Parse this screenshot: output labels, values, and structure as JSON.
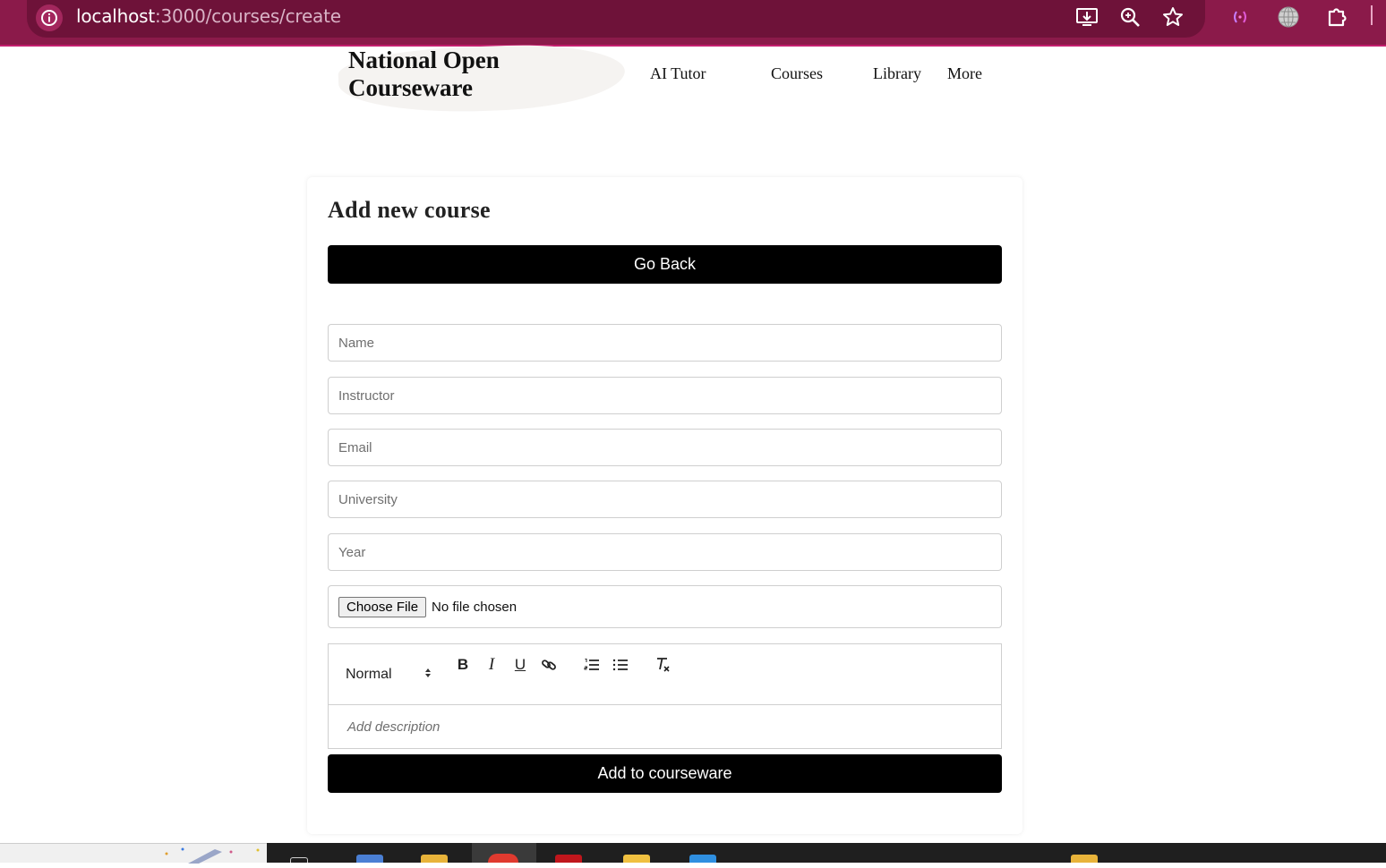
{
  "browser": {
    "url_host": "localhost",
    "url_path": ":3000/courses/create"
  },
  "site": {
    "logo_line1": "National Open",
    "logo_line2": "Courseware",
    "nav": [
      "AI Tutor",
      "Courses",
      "Library",
      "More"
    ]
  },
  "form": {
    "title": "Add new course",
    "go_back_label": "Go Back",
    "fields": {
      "name_placeholder": "Name",
      "instructor_placeholder": "Instructor",
      "email_placeholder": "Email",
      "university_placeholder": "University",
      "year_placeholder": "Year"
    },
    "file": {
      "button_label": "Choose File",
      "status": "No file chosen"
    },
    "editor": {
      "format_value": "Normal",
      "bold_label": "B",
      "italic_label": "I",
      "underline_label": "U",
      "description_placeholder": "Add description"
    },
    "submit_label": "Add to courseware"
  },
  "colors": {
    "browser_bar": "#8b1a4a",
    "button": "#000000"
  }
}
